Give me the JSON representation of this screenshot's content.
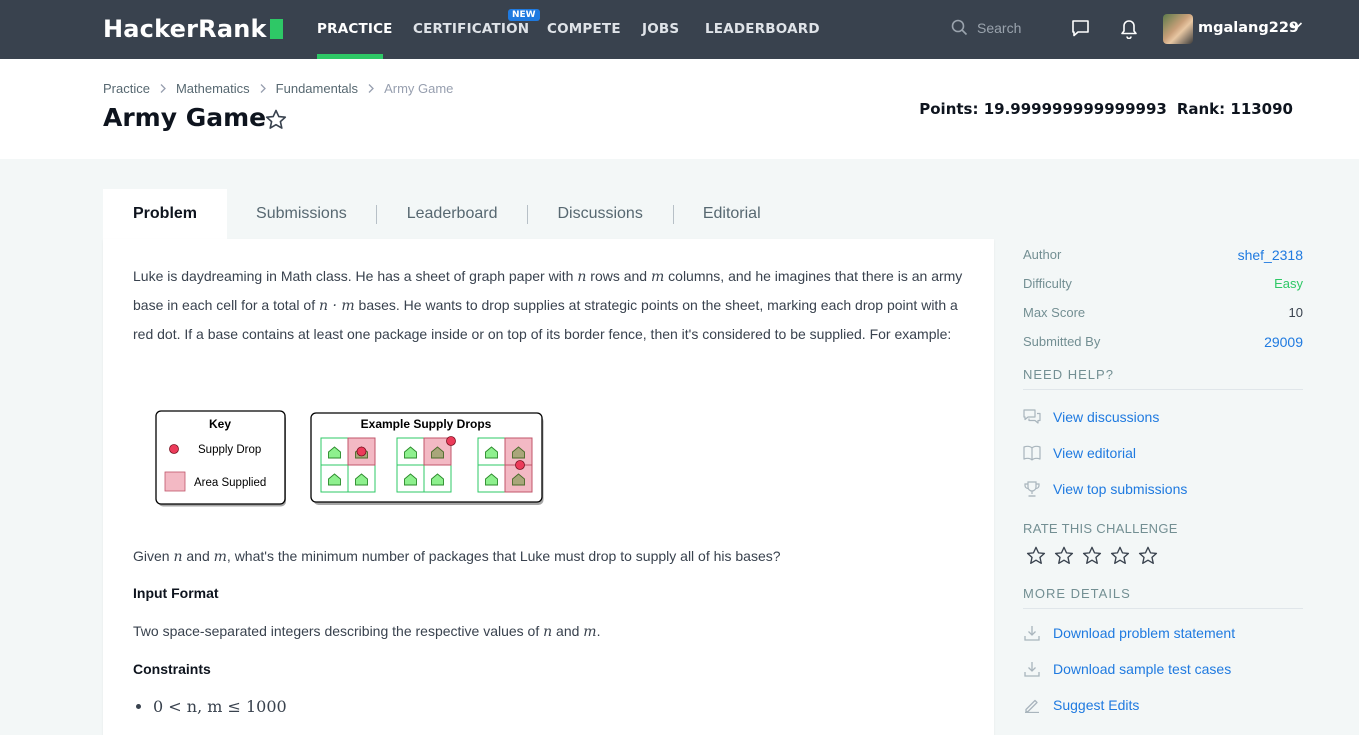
{
  "nav": {
    "logo_text": "HackerRank",
    "items": [
      "PRACTICE",
      "CERTIFICATION",
      "COMPETE",
      "JOBS",
      "LEADERBOARD"
    ],
    "active": "PRACTICE",
    "new_badge": "NEW",
    "search_placeholder": "Search",
    "username": "mgalang229"
  },
  "breadcrumb": [
    "Practice",
    "Mathematics",
    "Fundamentals",
    "Army Game"
  ],
  "page_title": "Army Game",
  "stats": {
    "points": "Points: 19.999999999999993",
    "rank": "Rank: 113090"
  },
  "tabs": [
    "Problem",
    "Submissions",
    "Leaderboard",
    "Discussions",
    "Editorial"
  ],
  "problem": {
    "p1_a": "Luke is daydreaming in Math class. He has a sheet of graph paper with ",
    "n": "n",
    "p1_b": " rows and ",
    "m": "m",
    "p1_c": " columns, and he imagines that there is an army base in each cell for a total of ",
    "nm": "n · m",
    "p1_d": " bases. He wants to drop supplies at strategic points on the sheet, marking each drop point with a red dot. If a base contains at least one package inside or on top of its border fence, then it's considered to be supplied. For example:",
    "q_a": "Given ",
    "q_b": " and ",
    "q_c": ", what's the minimum number of packages that Luke must drop to supply all of his bases?",
    "input_heading": "Input Format",
    "input_a": "Two space-separated integers describing the respective values of ",
    "input_b": " and ",
    "input_c": ".",
    "constraints_heading": "Constraints",
    "constraint": "0 < n, m ≤ 1000"
  },
  "figure": {
    "key_title": "Key",
    "supply_drop": "Supply Drop",
    "area_supplied": "Area Supplied",
    "example_title": "Example Supply Drops"
  },
  "sidebar": {
    "meta": [
      {
        "label": "Author",
        "value": "shef_2318"
      },
      {
        "label": "Difficulty",
        "value": "Easy"
      },
      {
        "label": "Max Score",
        "value": "10"
      },
      {
        "label": "Submitted By",
        "value": "29009"
      }
    ],
    "need_help": "NEED HELP?",
    "help_links": [
      "View discussions",
      "View editorial",
      "View top submissions"
    ],
    "rate_title": "RATE THIS CHALLENGE",
    "more_details": "MORE DETAILS",
    "detail_links": [
      "Download problem statement",
      "Download sample test cases",
      "Suggest Edits"
    ]
  },
  "colors": {
    "nav_bg": "#39424e",
    "accent_green": "#2ec866",
    "link_blue": "#1f7ae0"
  }
}
